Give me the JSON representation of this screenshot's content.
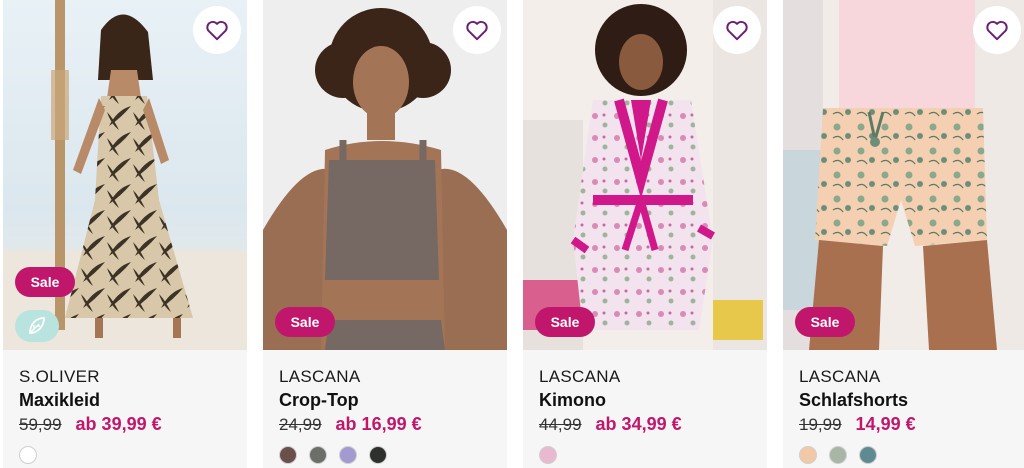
{
  "colors": {
    "accent": "#c0176c",
    "card_bg": "#f6f6f6",
    "heart": "#6a1f74",
    "eco": "#b9e3df"
  },
  "products": [
    {
      "brand": "S.OLIVER",
      "name": "Maxikleid",
      "old_price": "59,99",
      "new_price": "ab 39,99 €",
      "badge": "Sale",
      "eco_icon": "leaf-icon",
      "swatches": [
        "#ffffff"
      ]
    },
    {
      "brand": "LASCANA",
      "name": "Crop-Top",
      "old_price": "24,99",
      "new_price": "ab 16,99 €",
      "badge": "Sale",
      "swatches": [
        "#6b4f4a",
        "#6c6e69",
        "#a39bd0",
        "#2e302e"
      ]
    },
    {
      "brand": "LASCANA",
      "name": "Kimono",
      "old_price": "44,99",
      "new_price": "ab 34,99 €",
      "badge": "Sale",
      "swatches": [
        "#e9b9cf"
      ]
    },
    {
      "brand": "LASCANA",
      "name": "Schlafshorts",
      "old_price": "19,99",
      "new_price": "14,99 €",
      "badge": "Sale",
      "swatches": [
        "#f2c9a7",
        "#a8b6a5",
        "#5e8b92"
      ]
    }
  ]
}
